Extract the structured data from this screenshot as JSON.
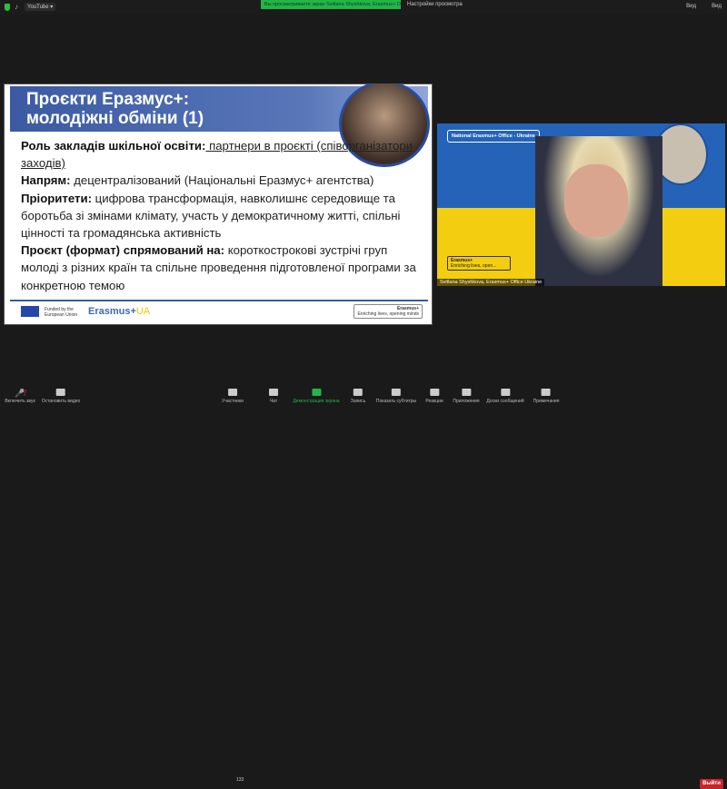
{
  "topbar": {
    "source_label": "YouTube ▾",
    "banner": "Вы просматриваете экран Svitlana Shyshkova, Erasmus+ O...",
    "view_settings": "Настройки просмотра",
    "view": "Вид",
    "fullscreen": "Вид"
  },
  "slide": {
    "title1": "Проєкти Еразмус+:",
    "title2": "молодіжні обміни (1)",
    "p1_label": "Роль закладів шкільної освіти:",
    "p1_text": " партнери в проєкті (співорганізатори заходів)",
    "p2_label": "Напрям:",
    "p2_text": " децентралізований (Національні Еразмус+ агентства)",
    "p3_label": "Пріоритети:",
    "p3_text": " цифрова трансформація, навколишнє середовище та боротьба зі змінами клімату, участь у демократичному житті, спільні цінності та громадянська активність",
    "p4_label": "Проєкт (формат) спрямований на:",
    "p4_text": " короткострокові зустрічі груп молоді з різних країн та спільне проведення підготовленої програми за конкретною темою",
    "funded": "Funded by the European Union",
    "erasmus_ua_a": "Erasmus+",
    "erasmus_ua_b": "UA",
    "right_logo_title": "Erasmus+",
    "right_logo_sub": "Enriching lives, opening minds"
  },
  "video": {
    "badge": "National Erasmus+ Office - Ukraine",
    "box_title": "Erasmus+",
    "box_sub": "Enriching lives, open...",
    "name": "Svitlana Shyshkova, Erasmus+ Office Ukraine"
  },
  "toolbar": {
    "unmute": "Включить звук",
    "stop_video": "Остановить видео",
    "participants": "Участники",
    "participants_count": "133",
    "chat": "Чат",
    "share": "Демонстрация экрана",
    "record": "Запись",
    "captions": "Показать субтитры",
    "reactions": "Реакции",
    "apps": "Приложения",
    "whiteboards": "Доски сообщений",
    "notes": "Примечания",
    "leave": "Выйти"
  },
  "colors": {
    "share_green": "#23b54a",
    "leave_red": "#c8242d"
  }
}
